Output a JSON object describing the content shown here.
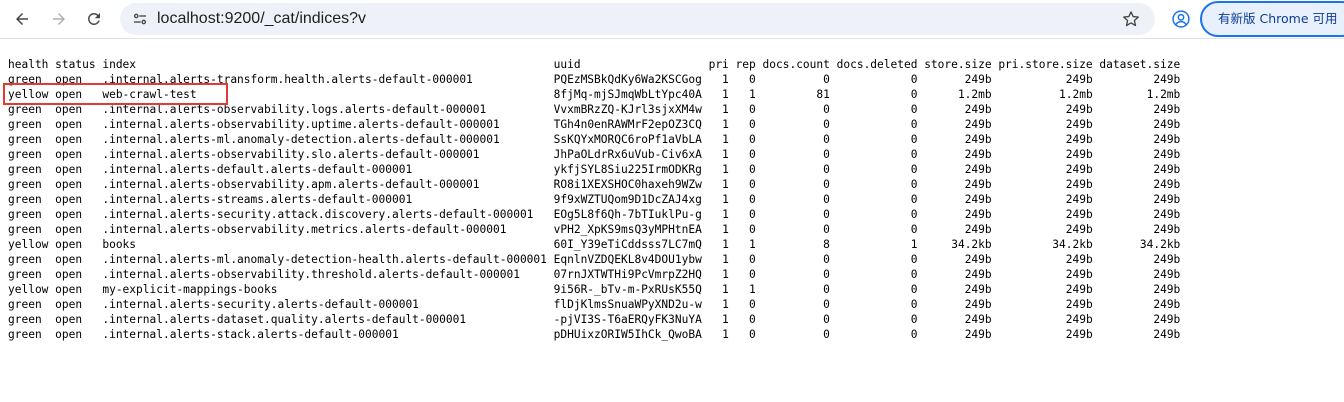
{
  "browser": {
    "url": "localhost:9200/_cat/indices?v",
    "update_label": "有新版 Chrome 可用"
  },
  "cat_output": {
    "header": [
      "health",
      "status",
      "index",
      "uuid",
      "pri",
      "rep",
      "docs.count",
      "docs.deleted",
      "store.size",
      "pri.store.size",
      "dataset.size"
    ],
    "rows": [
      [
        "green",
        "open",
        ".internal.alerts-transform.health.alerts-default-000001",
        "PQEzMSBkQdKy6Wa2KSCGog",
        "1",
        "0",
        "0",
        "0",
        "249b",
        "249b",
        "249b"
      ],
      [
        "yellow",
        "open",
        "web-crawl-test",
        "8fjMq-mjSJmqWbLtYpc40A",
        "1",
        "1",
        "81",
        "0",
        "1.2mb",
        "1.2mb",
        "1.2mb"
      ],
      [
        "green",
        "open",
        ".internal.alerts-observability.logs.alerts-default-000001",
        "VvxmBRzZQ-KJrl3sjxXM4w",
        "1",
        "0",
        "0",
        "0",
        "249b",
        "249b",
        "249b"
      ],
      [
        "green",
        "open",
        ".internal.alerts-observability.uptime.alerts-default-000001",
        "TGh4n0enRAWMrF2epOZ3CQ",
        "1",
        "0",
        "0",
        "0",
        "249b",
        "249b",
        "249b"
      ],
      [
        "green",
        "open",
        ".internal.alerts-ml.anomaly-detection.alerts-default-000001",
        "SsKQYxMORQC6roPf1aVbLA",
        "1",
        "0",
        "0",
        "0",
        "249b",
        "249b",
        "249b"
      ],
      [
        "green",
        "open",
        ".internal.alerts-observability.slo.alerts-default-000001",
        "JhPaOLdrRx6uVub-Civ6xA",
        "1",
        "0",
        "0",
        "0",
        "249b",
        "249b",
        "249b"
      ],
      [
        "green",
        "open",
        ".internal.alerts-default.alerts-default-000001",
        "ykfjSYL8Siu225IrmODKRg",
        "1",
        "0",
        "0",
        "0",
        "249b",
        "249b",
        "249b"
      ],
      [
        "green",
        "open",
        ".internal.alerts-observability.apm.alerts-default-000001",
        "RO8i1XEXSHOC0haxeh9WZw",
        "1",
        "0",
        "0",
        "0",
        "249b",
        "249b",
        "249b"
      ],
      [
        "green",
        "open",
        ".internal.alerts-streams.alerts-default-000001",
        "9f9xWZTUQom9D1DcZAJ4xg",
        "1",
        "0",
        "0",
        "0",
        "249b",
        "249b",
        "249b"
      ],
      [
        "green",
        "open",
        ".internal.alerts-security.attack.discovery.alerts-default-000001",
        "EOg5L8f6Qh-7bTIuklPu-g",
        "1",
        "0",
        "0",
        "0",
        "249b",
        "249b",
        "249b"
      ],
      [
        "green",
        "open",
        ".internal.alerts-observability.metrics.alerts-default-000001",
        "vPH2_XpKS9msQ3yMPHtnEA",
        "1",
        "0",
        "0",
        "0",
        "249b",
        "249b",
        "249b"
      ],
      [
        "yellow",
        "open",
        "books",
        "60I_Y39eTiCddsss7LC7mQ",
        "1",
        "1",
        "8",
        "1",
        "34.2kb",
        "34.2kb",
        "34.2kb"
      ],
      [
        "green",
        "open",
        ".internal.alerts-ml.anomaly-detection-health.alerts-default-000001",
        "EqnlnVZDQEKL8v4DOU1ybw",
        "1",
        "0",
        "0",
        "0",
        "249b",
        "249b",
        "249b"
      ],
      [
        "green",
        "open",
        ".internal.alerts-observability.threshold.alerts-default-000001",
        "07rnJXTWTHi9PcVmrpZ2HQ",
        "1",
        "0",
        "0",
        "0",
        "249b",
        "249b",
        "249b"
      ],
      [
        "yellow",
        "open",
        "my-explicit-mappings-books",
        "9i56R-_bTv-m-PxRUsK55Q",
        "1",
        "1",
        "0",
        "0",
        "249b",
        "249b",
        "249b"
      ],
      [
        "green",
        "open",
        ".internal.alerts-security.alerts-default-000001",
        "flDjKlmsSnuaWPyXND2u-w",
        "1",
        "0",
        "0",
        "0",
        "249b",
        "249b",
        "249b"
      ],
      [
        "green",
        "open",
        ".internal.alerts-dataset.quality.alerts-default-000001",
        "-pjVI3S-T6aERQyFK3NuYA",
        "1",
        "0",
        "0",
        "0",
        "249b",
        "249b",
        "249b"
      ],
      [
        "green",
        "open",
        ".internal.alerts-stack.alerts-default-000001",
        "pDHUixzORIW5IhCk_QwoBA",
        "1",
        "0",
        "0",
        "0",
        "249b",
        "249b",
        "249b"
      ]
    ]
  },
  "colors": {
    "highlight_border": "#e53935",
    "accent": "#1a73e8"
  },
  "icons": [
    "back-arrow-icon",
    "forward-arrow-icon",
    "reload-icon",
    "site-info-icon",
    "bookmark-star-icon",
    "profile-icon"
  ]
}
